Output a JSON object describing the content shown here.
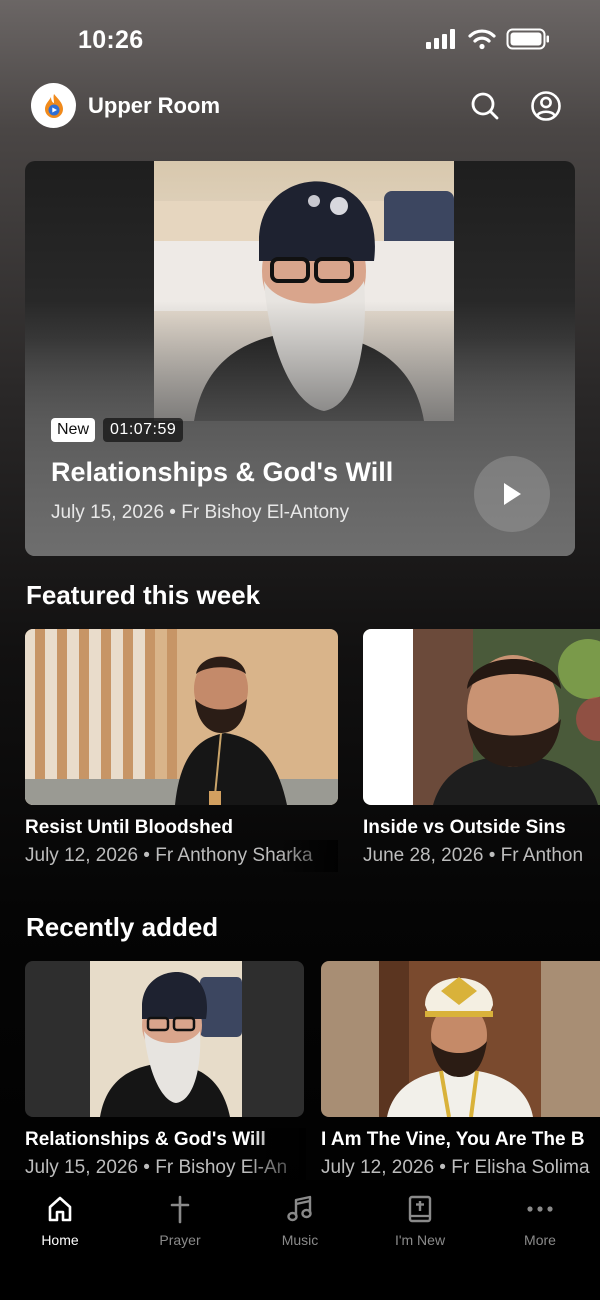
{
  "status_bar": {
    "time": "10:26"
  },
  "header": {
    "app_name": "Upper Room",
    "icons": [
      "search-icon",
      "profile-icon"
    ]
  },
  "hero": {
    "badge": "New",
    "duration": "01:07:59",
    "title": "Relationships & God's Will",
    "meta": "July 15, 2026 • Fr Bishoy El-Antony"
  },
  "featured": {
    "heading": "Featured this week",
    "items": [
      {
        "title": "Resist Until Bloodshed",
        "meta": "July 12, 2026 • Fr Anthony Sharka"
      },
      {
        "title": "Inside vs Outside Sins",
        "meta": "June 28, 2026 • Fr Anthon"
      }
    ]
  },
  "recent": {
    "heading": "Recently added",
    "items": [
      {
        "title": "Relationships & God's Will",
        "meta": "July 15, 2026 • Fr Bishoy El-An"
      },
      {
        "title": "I Am The Vine, You Are The B",
        "meta": "July 12, 2026 • Fr Elisha Solima"
      }
    ]
  },
  "tabs": [
    {
      "label": "Home",
      "icon": "home-icon",
      "active": true
    },
    {
      "label": "Prayer",
      "icon": "cross-icon",
      "active": false
    },
    {
      "label": "Music",
      "icon": "music-note-icon",
      "active": false
    },
    {
      "label": "I'm New",
      "icon": "bible-icon",
      "active": false
    },
    {
      "label": "More",
      "icon": "more-dots-icon",
      "active": false
    }
  ],
  "colors": {
    "active_tab": "#ffffff",
    "inactive_tab": "#8a8a8a",
    "logo_flame": "#f08a1c",
    "logo_blue": "#2f6fd6"
  }
}
